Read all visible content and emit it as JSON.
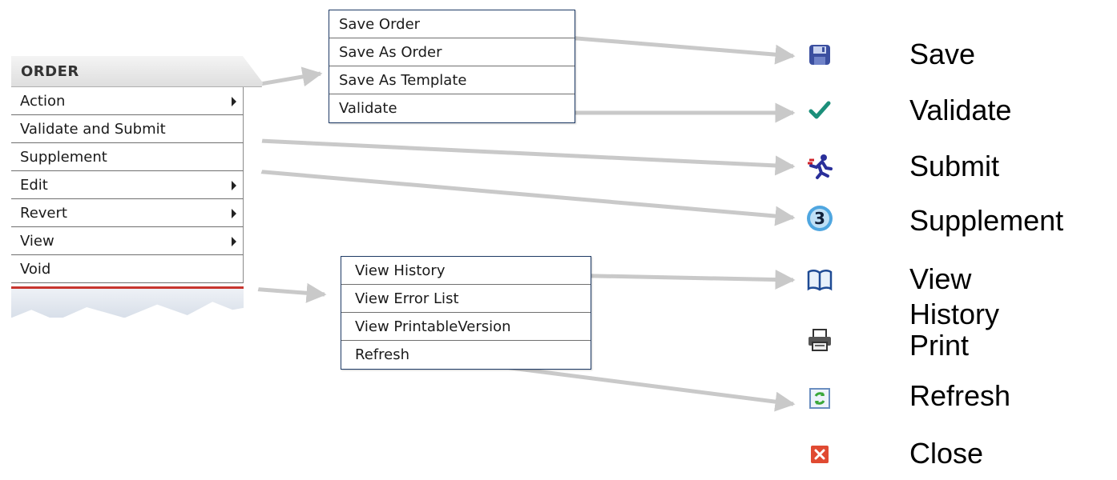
{
  "order_menu": {
    "header": "ORDER",
    "items": [
      {
        "label": "Action",
        "has_submenu": true
      },
      {
        "label": "Validate and Submit",
        "has_submenu": false
      },
      {
        "label": "Supplement",
        "has_submenu": false
      },
      {
        "label": "Edit",
        "has_submenu": true
      },
      {
        "label": "Revert",
        "has_submenu": true
      },
      {
        "label": "View",
        "has_submenu": true
      },
      {
        "label": "Void",
        "has_submenu": false
      }
    ]
  },
  "action_submenu": {
    "items": [
      "Save Order",
      "Save As Order",
      "Save As Template",
      "Validate"
    ]
  },
  "view_submenu": {
    "items": [
      "View History",
      "View Error List",
      "View PrintableVersion",
      "Refresh"
    ]
  },
  "legend": [
    {
      "icon": "floppy-disk-icon",
      "label": "Save"
    },
    {
      "icon": "checkmark-icon",
      "label": "Validate"
    },
    {
      "icon": "running-person-icon",
      "label": "Submit"
    },
    {
      "icon": "number-three-icon",
      "label": "Supplement"
    },
    {
      "icon": "open-book-icon",
      "label": "View History"
    },
    {
      "icon": "printer-icon",
      "label": "Print"
    },
    {
      "icon": "refresh-icon",
      "label": "Refresh"
    },
    {
      "icon": "close-icon",
      "label": "Close"
    }
  ],
  "colors": {
    "arrow": "#c9c9c9",
    "menu_border": "#1f3b66",
    "footer_accent": "#c8362f",
    "check": "#1b8f7a",
    "close": "#e04a32",
    "refresh": "#3aa83a"
  }
}
